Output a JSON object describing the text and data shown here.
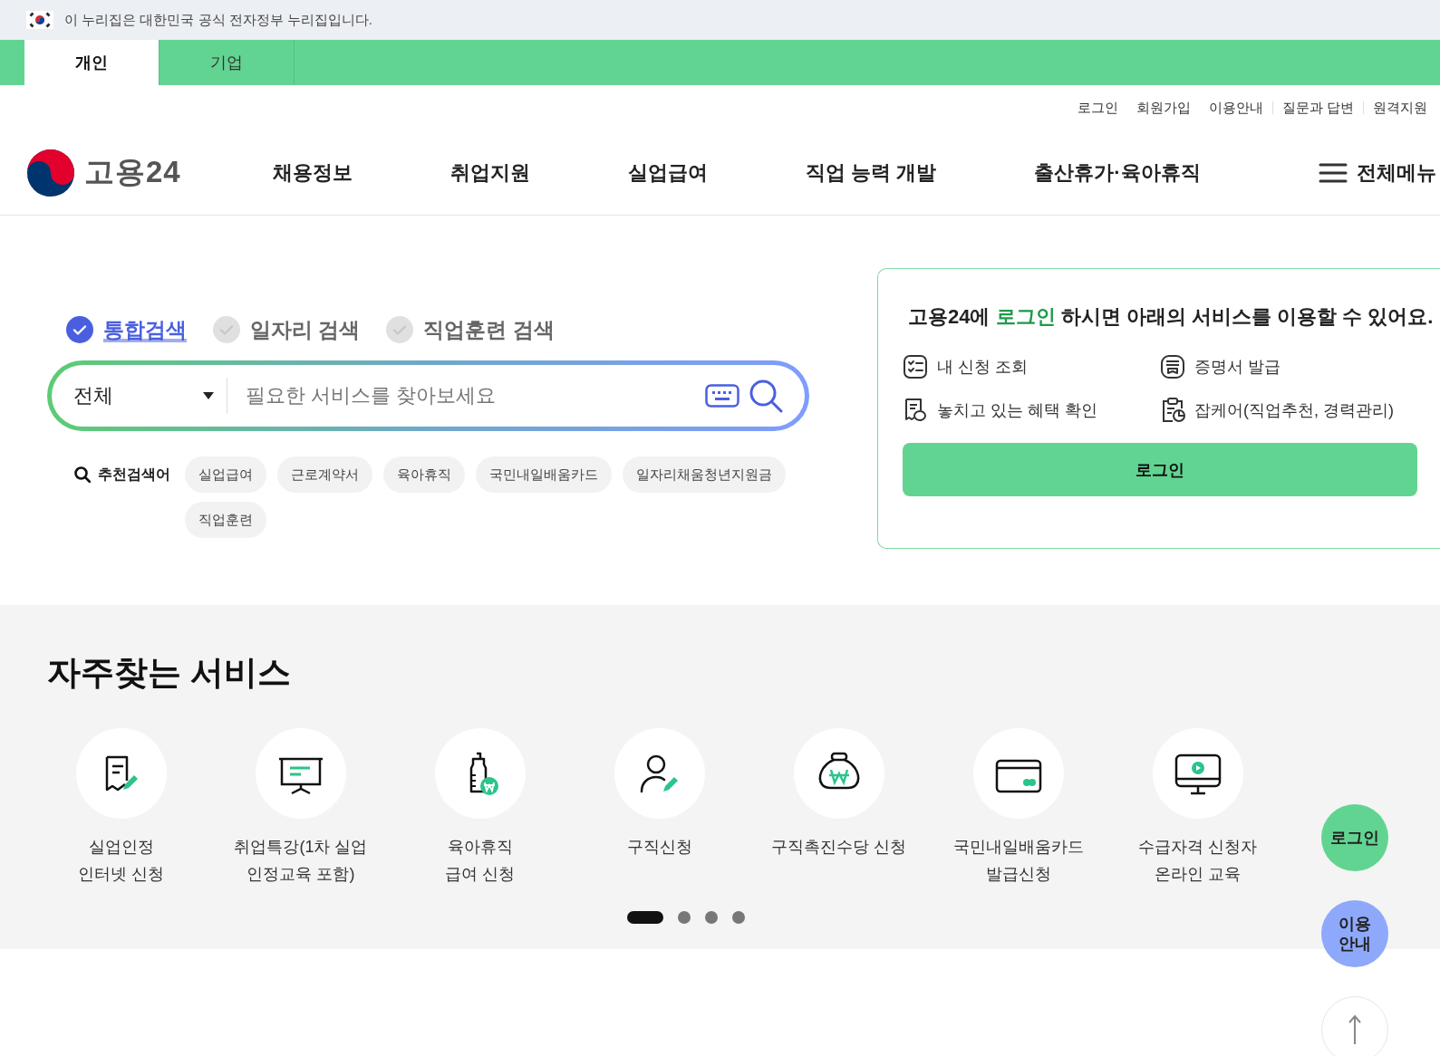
{
  "gov_banner": {
    "text": "이 누리집은 대한민국 공식 전자정부 누리집입니다."
  },
  "audience_tabs": [
    {
      "label": "개인",
      "selected": true
    },
    {
      "label": "기업",
      "selected": false
    }
  ],
  "utility_links": [
    "로그인",
    "회원가입",
    "이용안내",
    "질문과 답변",
    "원격지원"
  ],
  "header": {
    "logo_text": "고용24",
    "nav": [
      "채용정보",
      "취업지원",
      "실업급여",
      "직업 능력 개발",
      "출산휴가·육아휴직"
    ],
    "all_menu": "전체메뉴"
  },
  "search": {
    "types": [
      {
        "label": "통합검색",
        "selected": true
      },
      {
        "label": "일자리 검색",
        "selected": false
      },
      {
        "label": "직업훈련 검색",
        "selected": false
      }
    ],
    "scope": "전체",
    "placeholder": "필요한 서비스를 찾아보세요",
    "suggest_label": "추천검색어",
    "suggestions": [
      "실업급여",
      "근로계약서",
      "육아휴직",
      "국민내일배움카드",
      "일자리채움청년지원금",
      "직업훈련"
    ]
  },
  "login_card": {
    "title": "고용24에 **로그인** 하시면 아래의 서비스를 이용할 수 있어요.",
    "benefits": [
      {
        "kind": "checklist",
        "label": "내 신청 조회"
      },
      {
        "kind": "certificate",
        "label": "증명서 발급"
      },
      {
        "kind": "receipt",
        "label": "놓치고 있는 혜택 확인"
      },
      {
        "kind": "clipboard",
        "label": "잡케어(직업추천, 경력관리)"
      }
    ],
    "button": "로그인"
  },
  "services": {
    "title": "자주찾는 서비스",
    "items": [
      {
        "kind": "document-pen",
        "lines": [
          "실업인정",
          "인터넷 신청"
        ]
      },
      {
        "kind": "presentation",
        "lines": [
          "취업특강(1차 실업",
          "인정교육 포함)"
        ]
      },
      {
        "kind": "bottle",
        "lines": [
          "육아휴직",
          "급여 신청"
        ]
      },
      {
        "kind": "person-pen",
        "lines": [
          "구직신청"
        ]
      },
      {
        "kind": "money-bag",
        "lines": [
          "구직촉진수당 신청"
        ]
      },
      {
        "kind": "card",
        "lines": [
          "국민내일배움카드",
          "발급신청"
        ]
      },
      {
        "kind": "monitor",
        "lines": [
          "수급자격 신청자",
          "온라인 교육"
        ]
      }
    ],
    "pages": [
      {
        "selected": true
      },
      {
        "selected": false
      },
      {
        "selected": false
      },
      {
        "selected": false
      }
    ]
  },
  "floating": {
    "login": "로그인",
    "guide": "이용안내"
  }
}
